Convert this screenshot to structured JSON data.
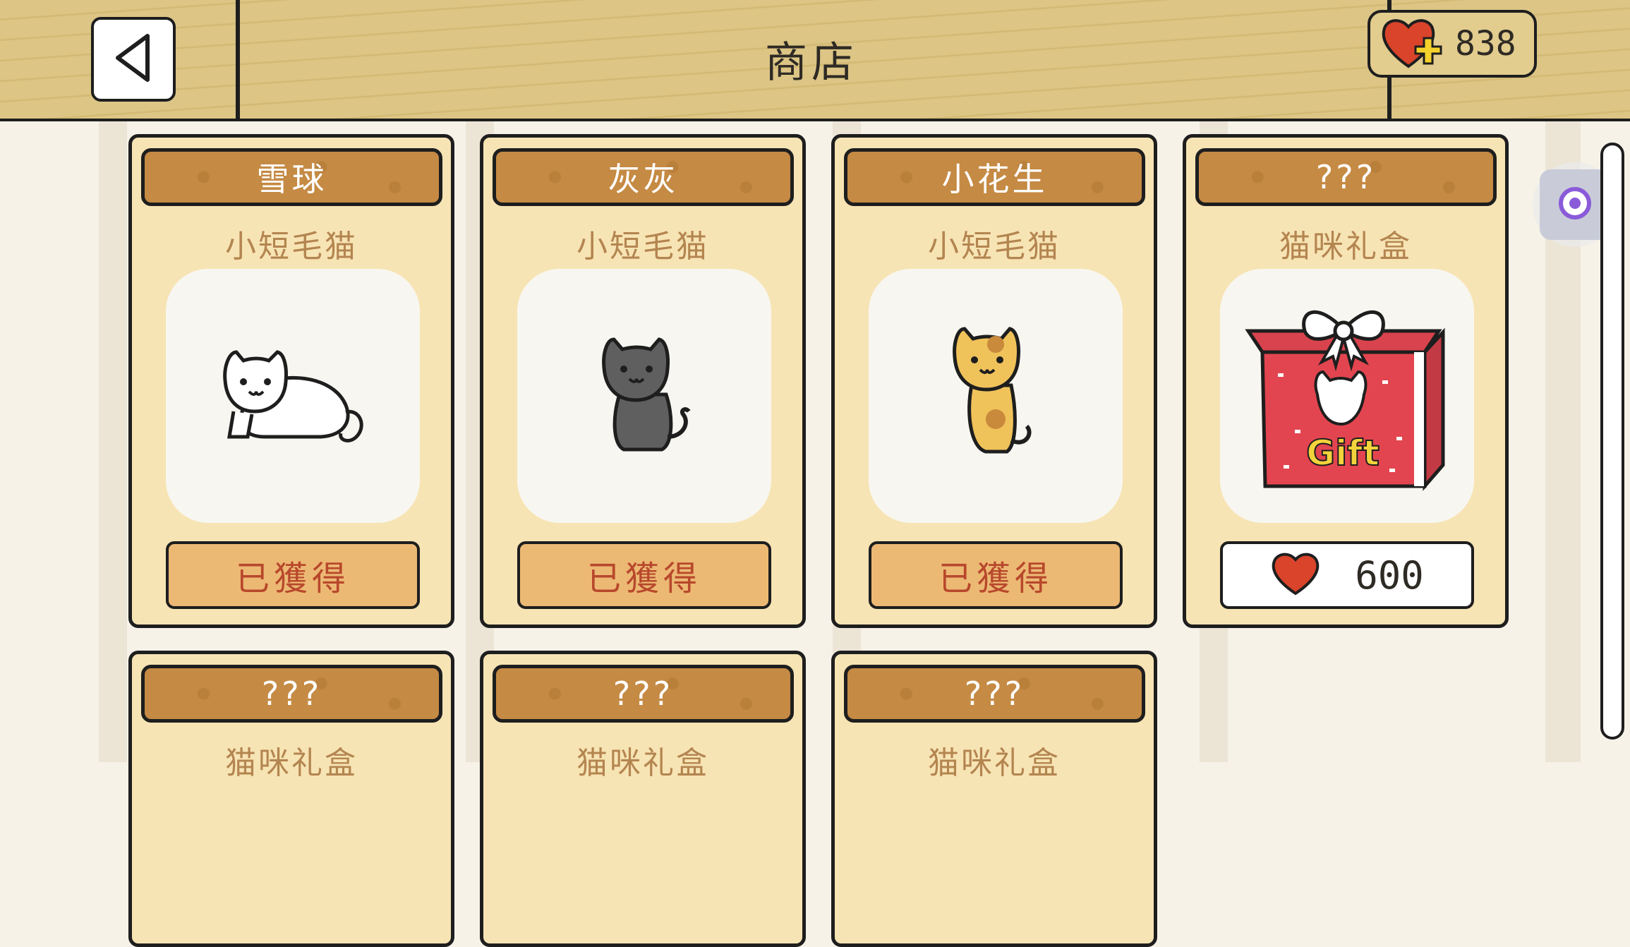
{
  "header": {
    "title": "商店",
    "hearts_count": "838",
    "back_icon": "back-triangle-icon",
    "heart_plus_icon": "heart-plus-icon"
  },
  "cards": [
    {
      "name": "雪球",
      "breed": "小短毛猫",
      "status": "已獲得",
      "image_icon": "white-cat-lying-icon"
    },
    {
      "name": "灰灰",
      "breed": "小短毛猫",
      "status": "已獲得",
      "image_icon": "gray-cat-sitting-icon"
    },
    {
      "name": "小花生",
      "breed": "小短毛猫",
      "status": "已獲得",
      "image_icon": "calico-cat-standing-icon"
    },
    {
      "name": "???",
      "breed": "猫咪礼盒",
      "price": "600",
      "image_icon": "gift-box-icon",
      "gift_text": "Gift"
    }
  ],
  "partial_cards": [
    {
      "name": "???",
      "breed": "猫咪礼盒"
    },
    {
      "name": "???",
      "breed": "猫咪礼盒"
    },
    {
      "name": "???",
      "breed": "猫咪礼盒"
    }
  ],
  "colors": {
    "wood": "#dcc585",
    "card_bg": "#f7e4b4",
    "banner": "#c58a44",
    "owned_button": "#ecb974",
    "owned_text": "#b8482c",
    "heart_red": "#d9442b"
  }
}
